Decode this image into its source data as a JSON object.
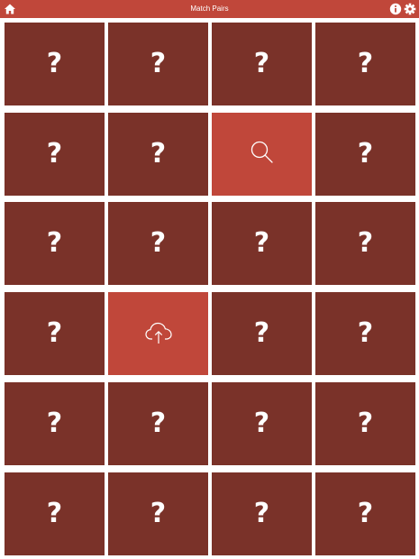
{
  "header": {
    "title": "Match Pairs",
    "home_icon": "home-icon",
    "info_icon": "info-icon",
    "settings_icon": "gear-icon"
  },
  "colors": {
    "bar": "#c0473a",
    "tile_hidden": "#7a3229",
    "tile_revealed": "#c0473a",
    "symbol": "#ffffff"
  },
  "board": {
    "columns": 4,
    "rows": 6,
    "hidden_symbol": "?",
    "tiles": [
      {
        "state": "hidden"
      },
      {
        "state": "hidden"
      },
      {
        "state": "hidden"
      },
      {
        "state": "hidden"
      },
      {
        "state": "hidden"
      },
      {
        "state": "hidden"
      },
      {
        "state": "revealed",
        "icon": "search-icon"
      },
      {
        "state": "hidden"
      },
      {
        "state": "hidden"
      },
      {
        "state": "hidden"
      },
      {
        "state": "hidden"
      },
      {
        "state": "hidden"
      },
      {
        "state": "hidden"
      },
      {
        "state": "revealed",
        "icon": "cloud-upload-icon"
      },
      {
        "state": "hidden"
      },
      {
        "state": "hidden"
      },
      {
        "state": "hidden"
      },
      {
        "state": "hidden"
      },
      {
        "state": "hidden"
      },
      {
        "state": "hidden"
      },
      {
        "state": "hidden"
      },
      {
        "state": "hidden"
      },
      {
        "state": "hidden"
      },
      {
        "state": "hidden"
      }
    ]
  }
}
